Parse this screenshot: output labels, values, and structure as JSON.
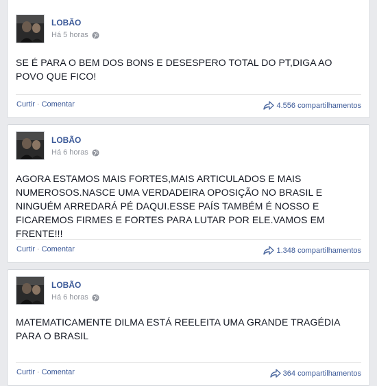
{
  "posts": [
    {
      "author": "LOBÃO",
      "time": "Há 5 horas",
      "text": "SE É PARA O BEM DOS BONS E DESESPERO TOTAL DO PT,DIGA AO POVO QUE FICO!",
      "like_label": "Curtir",
      "separator": "·",
      "comment_label": "Comentar",
      "shares": "4.556 compartilhamentos"
    },
    {
      "author": "LOBÃO",
      "time": "Há 6 horas",
      "text": "AGORA ESTAMOS MAIS FORTES,MAIS ARTICULADOS E MAIS NUMEROSOS.NASCE UMA VERDADEIRA OPOSIÇÃO NO BRASIL E NINGUÉM ARREDARÁ PÉ DAQUI.ESSE PAÍS TAMBÉM É NOSSO E FICAREMOS FIRMES E FORTES PARA LUTAR POR ELE.VAMOS EM FRENTE!!!",
      "like_label": "Curtir",
      "separator": "·",
      "comment_label": "Comentar",
      "shares": "1.348 compartilhamentos"
    },
    {
      "author": "LOBÃO",
      "time": "Há 6 horas",
      "text": "MATEMATICAMENTE DILMA ESTÁ REELEITA UMA GRANDE TRAGÉDIA PARA O BRASIL",
      "like_label": "Curtir",
      "separator": "·",
      "comment_label": "Comentar",
      "shares": "364 compartilhamentos"
    }
  ],
  "colors": {
    "link": "#3b5998",
    "text": "#141823",
    "meta": "#90949c",
    "background": "#e9eaed"
  }
}
